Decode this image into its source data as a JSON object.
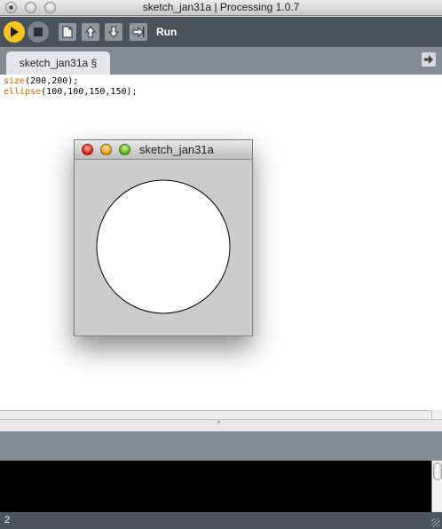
{
  "window": {
    "title": "sketch_jan31a | Processing 1.0.7"
  },
  "toolbar": {
    "run_label": "Run",
    "buttons": [
      "play-icon",
      "stop-icon",
      "new-file-icon",
      "open-icon",
      "save-icon",
      "export-icon"
    ],
    "accent": "#f9c51b"
  },
  "tabs": [
    {
      "label": "sketch_jan31a §"
    }
  ],
  "editor": {
    "lines": [
      {
        "fn": "size",
        "args": "(200,200);"
      },
      {
        "fn": "ellipse",
        "args": "(100,100,150,150);"
      }
    ],
    "keyword_color": "#cc6600"
  },
  "sketch_window": {
    "title": "sketch_jan31a",
    "background": "#cccccc"
  },
  "status": {
    "line_number": "2"
  }
}
